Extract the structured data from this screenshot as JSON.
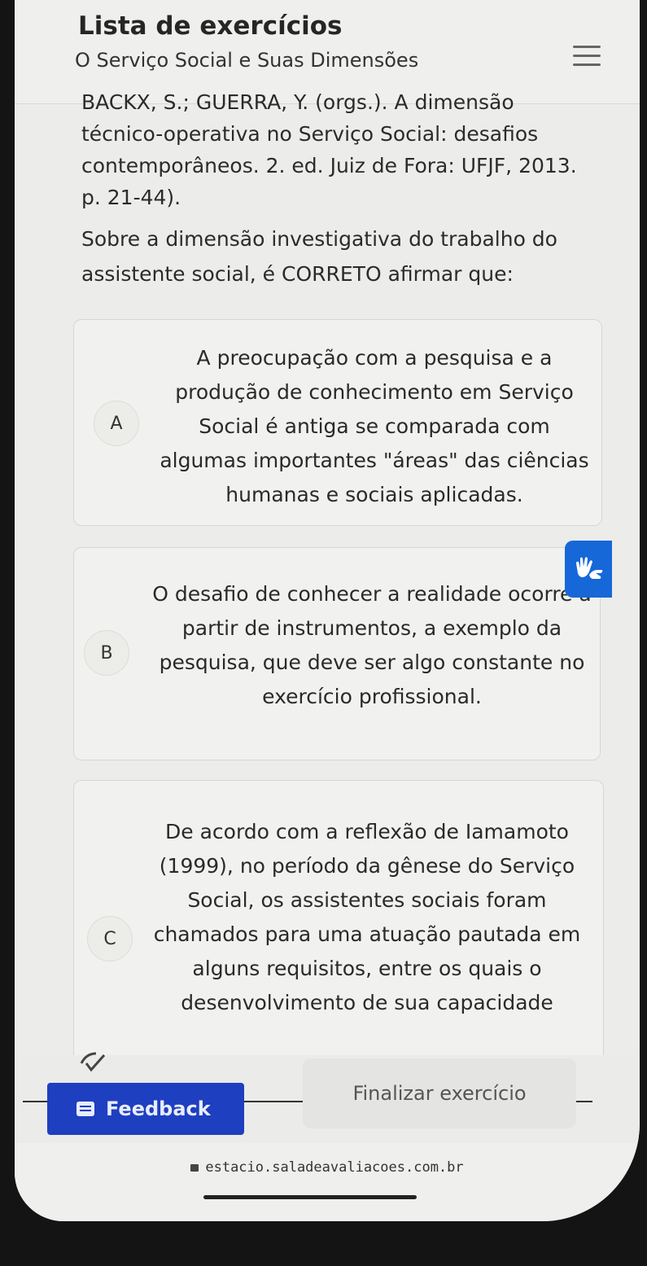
{
  "header": {
    "title": "Lista de exercícios",
    "subtitle": "O Serviço Social e Suas Dimensões"
  },
  "question": {
    "citation": "BACKX, S.; GUERRA, Y. (orgs.). A dimensão técnico-operativa no Serviço Social: desafios contemporâneos. 2. ed. Juiz de Fora: UFJF, 2013. p. 21-44).",
    "prompt": "Sobre a dimensão investigativa do trabalho do assistente social, é CORRETO afirmar que:"
  },
  "options": [
    {
      "letter": "A",
      "text": "A preocupação com a pesquisa e a produção de conhecimento em Serviço Social é antiga se comparada com algumas importantes \"áreas\" das ciências humanas e sociais aplicadas."
    },
    {
      "letter": "B",
      "text": "O desafio de conhecer a realidade ocorre a partir de instrumentos, a exemplo da pesquisa, que deve ser algo constante no exercício profissional."
    },
    {
      "letter": "C",
      "text": "De acordo com a reflexão de Iamamoto (1999), no período da gênese do Serviço Social, os assistentes sociais foram chamados para uma atuação pautada em alguns requisitos, entre os quais o desenvolvimento de sua capacidade"
    }
  ],
  "actions": {
    "feedback_label": "Feedback",
    "finalize_label": "Finalizar exercício"
  },
  "browser": {
    "url": "estacio.saladeavaliacoes.com.br"
  },
  "icons": {
    "menu": "hamburger-menu-icon",
    "libras": "sign-language-hands-icon",
    "feedback": "chat-icon",
    "check": "check-icon",
    "lock": "lock-icon"
  },
  "colors": {
    "accent_blue": "#1e3fbf",
    "libras_blue": "#1668d8"
  }
}
